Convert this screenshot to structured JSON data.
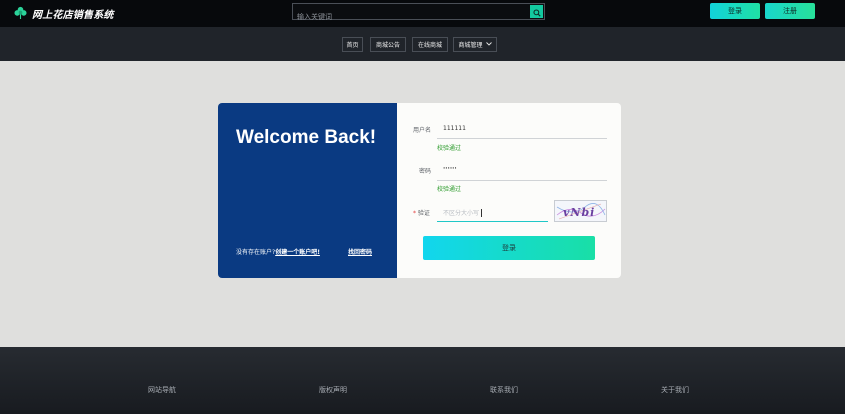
{
  "header": {
    "site_title": "网上花店销售系统",
    "search_placeholder": "输入关键词",
    "login_label": "登录",
    "register_label": "注册"
  },
  "nav": {
    "items": [
      {
        "label": "首页"
      },
      {
        "label": "商城公告"
      },
      {
        "label": "在线商城"
      },
      {
        "label": "商城管理"
      }
    ]
  },
  "login": {
    "welcome": "Welcome Back!",
    "no_account": "没有存在账户?",
    "create_account": "创建一个账户吧!",
    "forgot_password": "找回密码",
    "username_label": "用户名",
    "username_value": "111111",
    "username_valid": "校验通过",
    "password_label": "密码",
    "password_value": "······",
    "password_valid": "校验通过",
    "captcha_label": "验证",
    "captcha_required_mark": "*",
    "captcha_placeholder": "不区分大小写",
    "captcha_text": "vNbi",
    "submit_label": "登录"
  },
  "footer": {
    "links": [
      {
        "label": "网站导航"
      },
      {
        "label": "版权声明"
      },
      {
        "label": "联系我们"
      },
      {
        "label": "关于我们"
      }
    ]
  },
  "colors": {
    "accent": "#13c9a0",
    "panel": "#0a3a82",
    "valid": "#2a9a2a"
  }
}
